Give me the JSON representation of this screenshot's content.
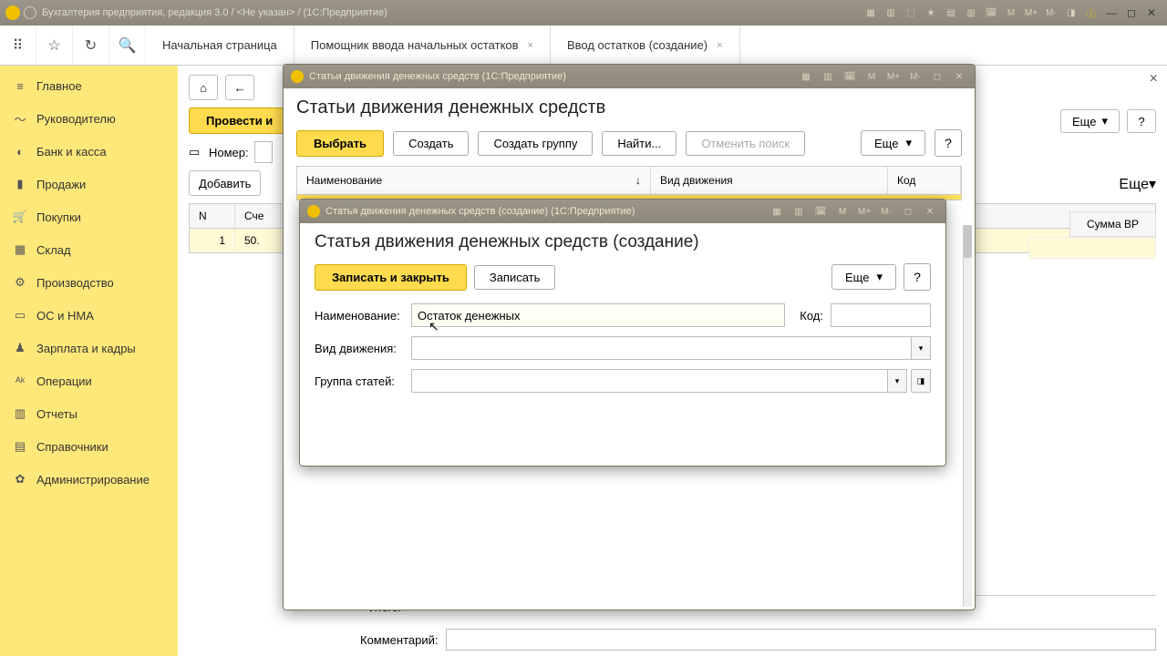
{
  "os_title": "Бухгалтерия предприятия, редакция 3.0 / <Не указан> / (1С:Предприятие)",
  "toolbar_letters": [
    "M",
    "M+",
    "M-"
  ],
  "main_tabs": {
    "home": "Начальная страница",
    "t1": "Помощник ввода начальных остатков",
    "t2": "Ввод остатков (создание)"
  },
  "sidebar": {
    "items": [
      {
        "icon": "≡",
        "label": "Главное"
      },
      {
        "icon": "〜",
        "label": "Руководителю"
      },
      {
        "icon": "◐",
        "label": "Банк и касса"
      },
      {
        "icon": "▮",
        "label": "Продажи"
      },
      {
        "icon": "🛒",
        "label": "Покупки"
      },
      {
        "icon": "▦",
        "label": "Склад"
      },
      {
        "icon": "⚙",
        "label": "Производство"
      },
      {
        "icon": "▭",
        "label": "ОС и НМА"
      },
      {
        "icon": "♟",
        "label": "Зарплата и кадры"
      },
      {
        "icon": "ᴬᵏ",
        "label": "Операции"
      },
      {
        "icon": "▥",
        "label": "Отчеты"
      },
      {
        "icon": "▤",
        "label": "Справочники"
      },
      {
        "icon": "✿",
        "label": "Администрирование"
      }
    ]
  },
  "content": {
    "provesti": "Провести и",
    "nomer": "Номер:",
    "dobavit": "Добавить",
    "col_n": "N",
    "col_sch": "Сче",
    "row_n": "1",
    "row_sch": "50.",
    "itogo": "Итого:",
    "comment": "Комментарий:",
    "esche": "Еще",
    "summa_vr": "Сумма ВР"
  },
  "dialog1": {
    "title": "Статьи движения денежных средств  (1С:Предприятие)",
    "header": "Статьи движения денежных средств",
    "vybrat": "Выбрать",
    "sozdat": "Создать",
    "sozdat_gr": "Создать группу",
    "nayti": "Найти...",
    "otmenit": "Отменить поиск",
    "esche": "Еще",
    "q": "?",
    "col1": "Наименование",
    "sort": "↓",
    "col2": "Вид движения",
    "col3": "Код"
  },
  "dialog2": {
    "title": "Статья движения денежных средств (создание)  (1С:Предприятие)",
    "header": "Статья движения денежных средств (создание)",
    "zapisat_zakryt": "Записать и закрыть",
    "zapisat": "Записать",
    "esche": "Еще",
    "q": "?",
    "naim": "Наименование:",
    "naim_val": "Остаток денежных",
    "kod": "Код:",
    "kod_val": "",
    "vid": "Вид движения:",
    "gruppa": "Группа статей:"
  }
}
